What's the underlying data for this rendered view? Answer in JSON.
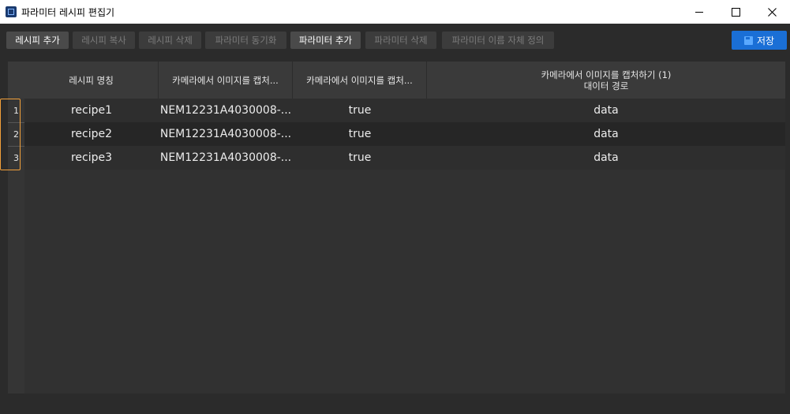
{
  "window": {
    "title": "파라미터 레시피 편집기",
    "icon": "app-icon",
    "controls": [
      "minimize-icon",
      "maximize-icon",
      "close-icon"
    ]
  },
  "toolbar": {
    "buttons": [
      {
        "label": "레시피 추가",
        "enabled": true
      },
      {
        "label": "레시피 복사",
        "enabled": false
      },
      {
        "label": "레시피 삭제",
        "enabled": false
      },
      {
        "label": "파라미터 동기화",
        "enabled": false
      },
      {
        "label": "파라미터 추가",
        "enabled": true
      },
      {
        "label": "파라미터 삭제",
        "enabled": false
      },
      {
        "label": "파라미터 이름 자체 정의",
        "enabled": false
      }
    ],
    "save_label": "저장",
    "save_icon": "floppy-disk-icon"
  },
  "table": {
    "columns": [
      {
        "label": "레시피 명칭"
      },
      {
        "label": "카메라에서 이미지를 캡처..."
      },
      {
        "label": "카메라에서 이미지를 캡처..."
      },
      {
        "line1": "카메라에서 이미지를 캡처하기 (1)",
        "line2": "대이터 경로"
      }
    ],
    "rows": [
      {
        "index": "1",
        "cells": [
          "recipe1",
          "NEM12231A4030008-...",
          "true",
          "data"
        ]
      },
      {
        "index": "2",
        "cells": [
          "recipe2",
          "NEM12231A4030008-...",
          "true",
          "data"
        ]
      },
      {
        "index": "3",
        "cells": [
          "recipe3",
          "NEM12231A4030008-...",
          "true",
          "data"
        ]
      }
    ]
  },
  "colors": {
    "background": "#2b2b2b",
    "accent": "#1a6fd6",
    "selection_outline": "#f2a03a"
  }
}
